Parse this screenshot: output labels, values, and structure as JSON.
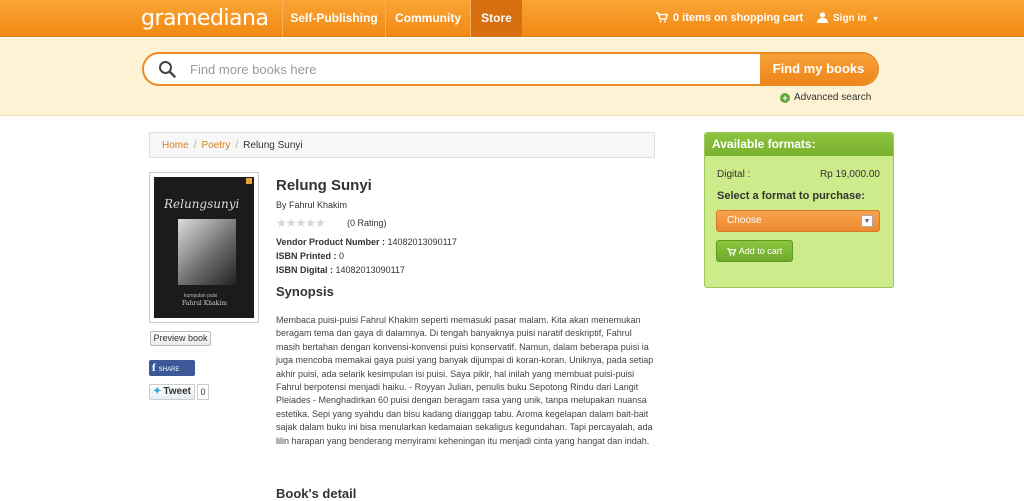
{
  "header": {
    "logo": "gramediana",
    "nav": [
      {
        "label": "Self-Publishing"
      },
      {
        "label": "Community"
      },
      {
        "label": "Store"
      }
    ],
    "cart_label": "0 items on shopping cart",
    "signin_label": "Sign in"
  },
  "search": {
    "placeholder": "Find more books here",
    "button_label": "Find my books",
    "advanced_label": "Advanced search"
  },
  "breadcrumb": [
    "Home",
    "Poetry",
    "Relung Sunyi"
  ],
  "book": {
    "title": "Relung Sunyi",
    "byline": "By Fahrul Khakim",
    "rating": 0,
    "rating_label": "(0 Rating)",
    "vendor_label": "Vendor Product Number :",
    "vendor_value": "14082013090117",
    "isbn_printed_label": "ISBN Printed :",
    "isbn_printed_value": "0",
    "isbn_digital_label": "ISBN Digital :",
    "isbn_digital_value": "14082013090117",
    "cover_title": "Relungsunyi",
    "cover_subtitle": "kumpulan puisi",
    "cover_author": "Fahrul Khakim"
  },
  "synopsis_heading": "Synopsis",
  "synopsis": "Membaca puisi-puisi Fahrul Khakim seperti memasuki pasar malam. Kita akan menemukan beragam tema dan gaya di dalamnya. Di tengah banyaknya puisi naratif deskriptif, Fahrul masih bertahan dengan konvensi-konvensi puisi konservatif. Namun, dalam beberapa puisi ia juga mencoba memakai gaya puisi yang banyak dijumpai di koran-koran. Uniknya, pada setiap akhir puisi, ada selarik kesimpulan isi puisi. Saya pikir, hal inilah yang membuat puisi-puisi Fahrul berpotensi menjadi haiku. - Royyan Julian, penulis buku Sepotong Rindu dari Langit Pleiades - Menghadirkan 60 puisi dengan beragam rasa yang unik, tanpa melupakan nuansa estetika. Sepi yang syahdu dan bisu kadang dianggap tabu. Aroma kegelapan dalam bait-bait sajak dalam buku ini bisa menularkan kedamaian sekaligus kegundahan. Tapi percayalah, ada lilin harapan yang benderang menyirami keheningan itu menjadi cinta yang hangat dan indah.",
  "details_heading": "Book's detail",
  "side": {
    "preview_label": "Preview book",
    "share_label": "SHARE",
    "tweet_label": "Tweet",
    "tweet_count": "0"
  },
  "formats": {
    "heading": "Available formats:",
    "digital_label": "Digital :",
    "digital_price": "Rp 19,000.00",
    "select_label": "Select a format to purchase:",
    "choose_label": "Choose",
    "add_cart_label": "Add to cart"
  },
  "colors": {
    "brand_orange": "#f28a14",
    "search_band": "#fdf3d4",
    "format_green": "#cdeb8b"
  }
}
